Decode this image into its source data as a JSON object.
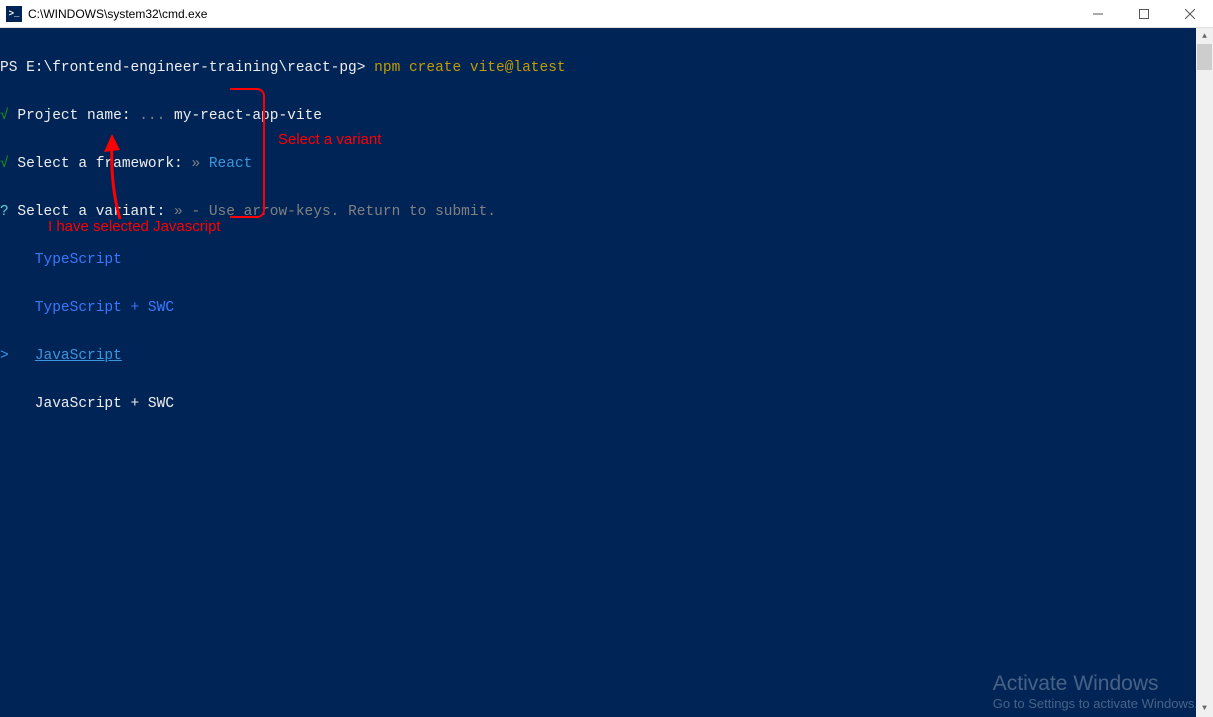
{
  "titlebar": {
    "icon_glyph": ">_",
    "title": "C:\\WINDOWS\\system32\\cmd.exe"
  },
  "terminal": {
    "prompt_prefix": "PS E:\\frontend-engineer-training\\react-pg> ",
    "command": "npm create vite@latest",
    "line2_check": "√",
    "line2_label": " Project name: ",
    "line2_dots": "... ",
    "line2_value": "my-react-app-vite",
    "line3_check": "√",
    "line3_label": " Select a framework: ",
    "line3_arrow": "» ",
    "line3_value": "React",
    "line4_q": "?",
    "line4_label": " Select a variant: ",
    "line4_arrow": "» ",
    "line4_hint": "- Use arrow-keys. Return to submit.",
    "opt1": "    TypeScript",
    "opt2": "    TypeScript + SWC",
    "opt3_marker": ">   ",
    "opt3_value": "JavaScript",
    "opt4": "    JavaScript + SWC"
  },
  "annotations": {
    "right_label": "Select a variant",
    "bottom_label": "I have selected Javascript"
  },
  "watermark": {
    "title": "Activate Windows",
    "sub": "Go to Settings to activate Windows."
  }
}
